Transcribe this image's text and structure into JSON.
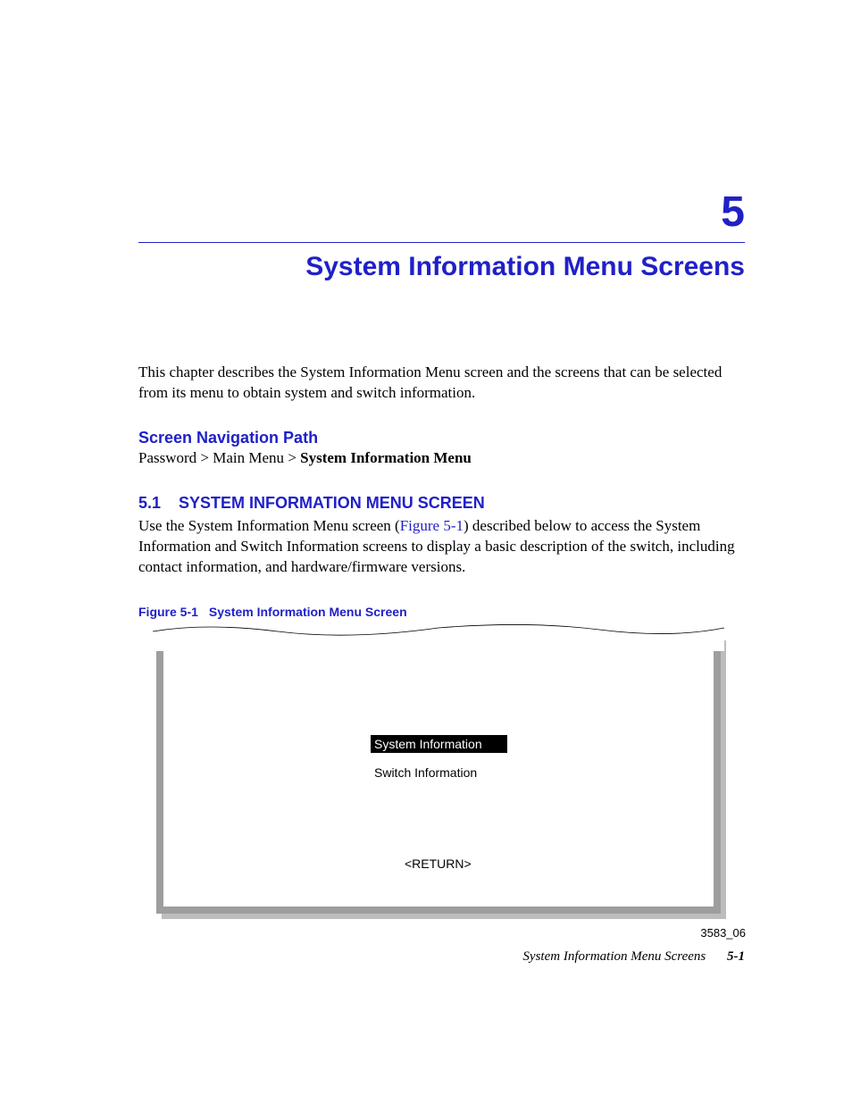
{
  "chapter": {
    "number": "5",
    "title": "System Information Menu Screens"
  },
  "intro": "This chapter describes the System Information Menu screen and the screens that can be selected from its menu to obtain system and switch information.",
  "nav": {
    "heading": "Screen Navigation Path",
    "path_prefix": "Password > Main Menu",
    "path_sep": " > ",
    "path_bold": "System Information Menu"
  },
  "section": {
    "number": "5.1",
    "title": "SYSTEM INFORMATION MENU SCREEN",
    "body_pre": "Use the System Information Menu screen (",
    "body_link": "Figure 5-1",
    "body_post": ") described below to access the System Information and Switch Information screens to display a basic description of the switch, including contact information, and hardware/firmware versions."
  },
  "figure": {
    "label": "Figure 5-1",
    "title": "System Information Menu Screen",
    "menu_selected": "System Information",
    "menu_other": "Switch Information",
    "return": "<RETURN>",
    "id": "3583_06"
  },
  "footer": {
    "text": "System Information Menu Screens",
    "page": "5-1"
  }
}
